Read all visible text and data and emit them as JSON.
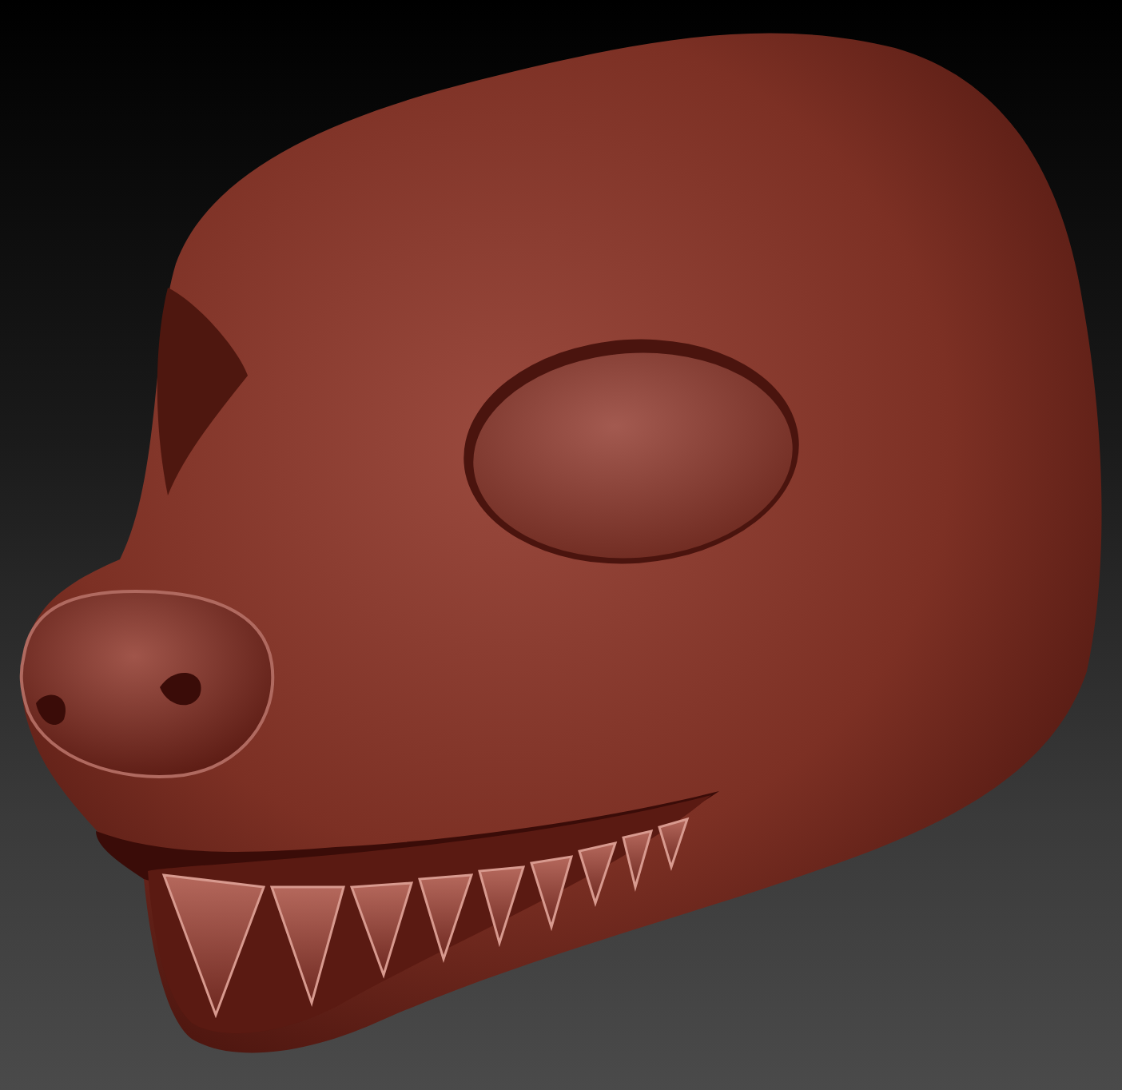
{
  "viewport": {
    "kind": "sculpt-render"
  }
}
